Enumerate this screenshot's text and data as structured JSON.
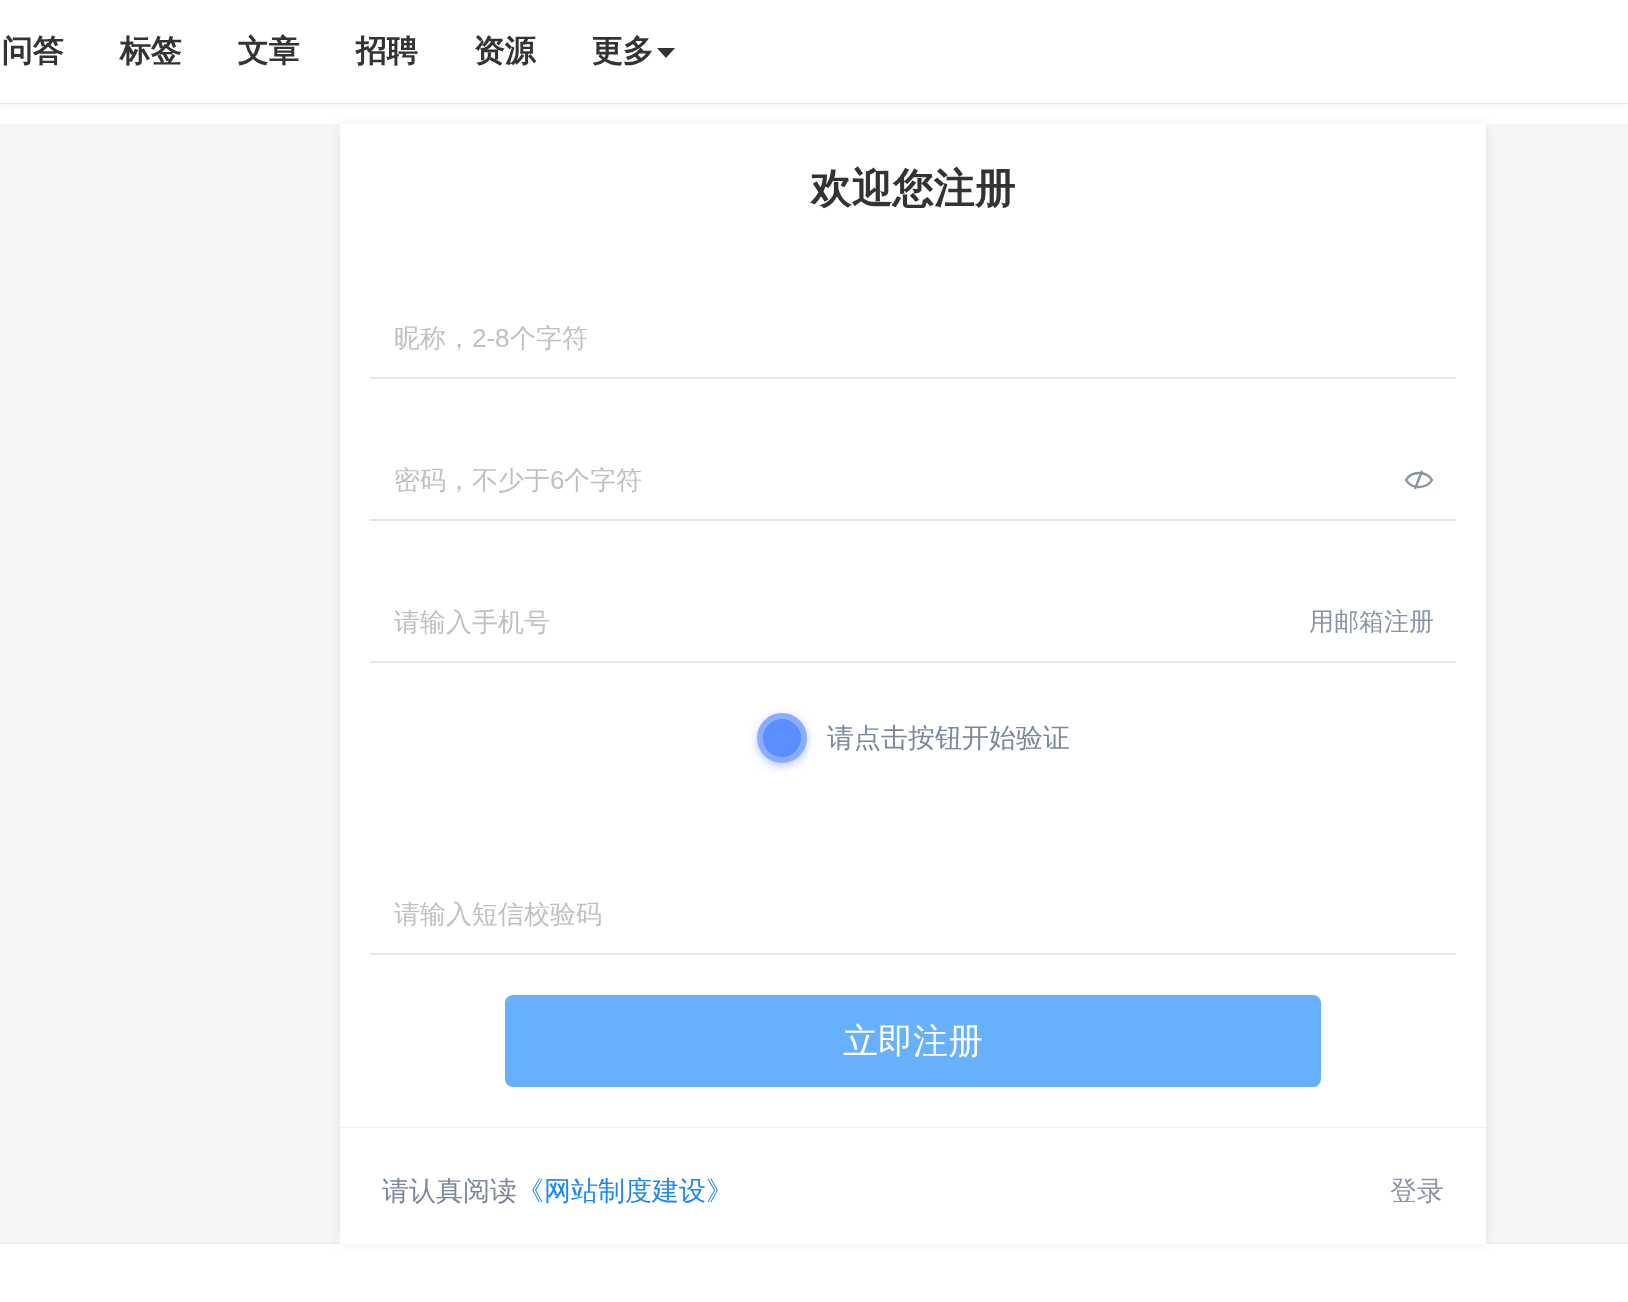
{
  "nav": {
    "items": [
      {
        "label": "问答",
        "kind": "link"
      },
      {
        "label": "标签",
        "kind": "link"
      },
      {
        "label": "文章",
        "kind": "link"
      },
      {
        "label": "招聘",
        "kind": "link"
      },
      {
        "label": "资源",
        "kind": "link"
      },
      {
        "label": "更多",
        "kind": "dropdown"
      }
    ]
  },
  "form": {
    "title": "欢迎您注册",
    "fields": [
      {
        "kind": "text",
        "placeholder": "昵称，2-8个字符"
      },
      {
        "kind": "password",
        "placeholder": "密码，不少于6个字符"
      },
      {
        "kind": "phone",
        "placeholder": "请输入手机号",
        "action": "用邮箱注册"
      },
      {
        "kind": "captcha",
        "label": "请点击按钮开始验证"
      },
      {
        "kind": "text",
        "placeholder": "请输入短信校验码"
      }
    ],
    "submit": "立即注册"
  },
  "footer": {
    "notice": "请认真阅读",
    "policy_link": "《网站制度建设》",
    "login": "登录"
  }
}
